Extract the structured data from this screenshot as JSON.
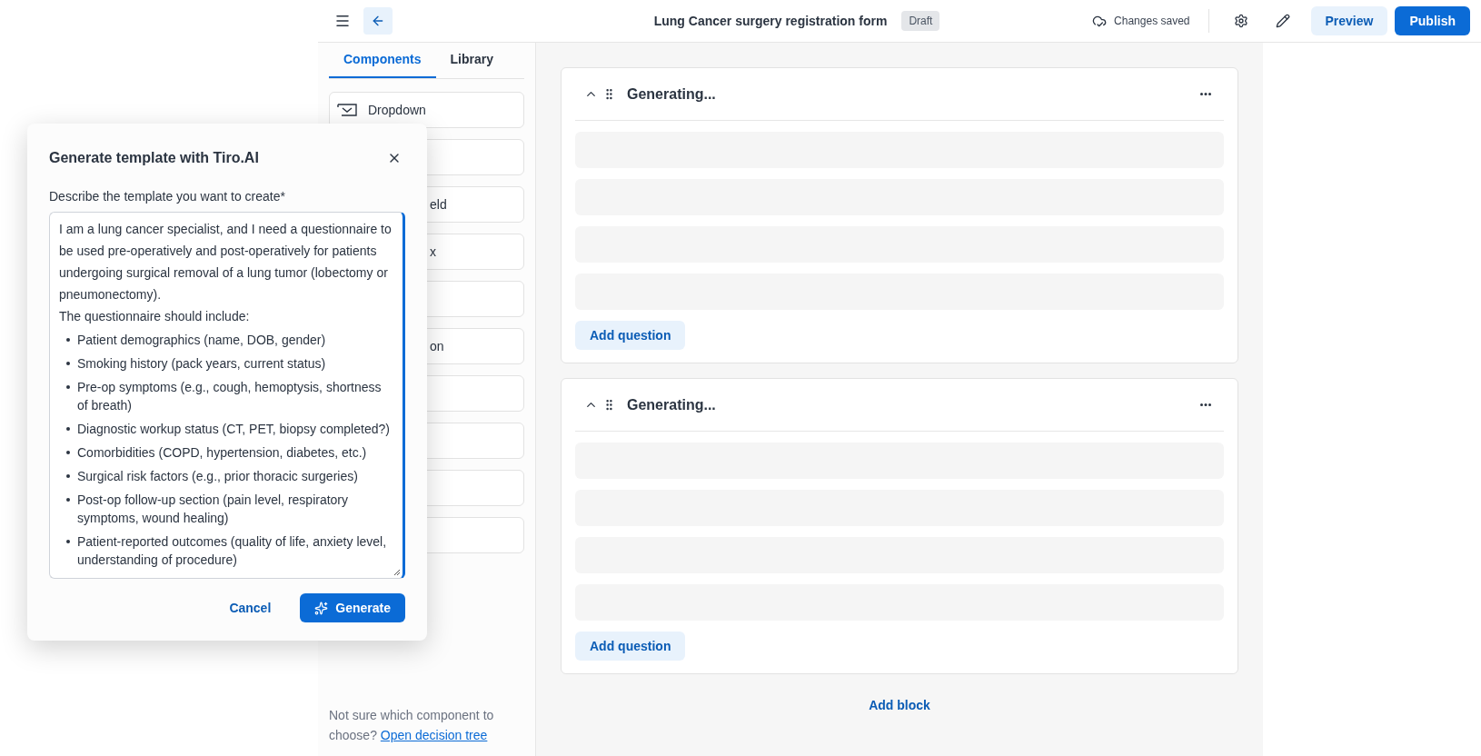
{
  "header": {
    "title": "Lung Cancer surgery registration form",
    "status": "Draft",
    "save_status": "Changes saved",
    "preview": "Preview",
    "publish": "Publish"
  },
  "sidebar": {
    "tabs": [
      {
        "label": "Components",
        "selected": true
      },
      {
        "label": "Library",
        "selected": false
      }
    ],
    "items": [
      {
        "kind": "dropdown",
        "label": "Dropdown"
      },
      {
        "kind": "covered"
      },
      {
        "kind": "covered",
        "label": "eld"
      },
      {
        "kind": "covered",
        "label": "x"
      },
      {
        "kind": "covered"
      },
      {
        "kind": "covered",
        "label": "on"
      },
      {
        "kind": "covered"
      },
      {
        "kind": "covered"
      },
      {
        "kind": "covered"
      },
      {
        "kind": "covered"
      }
    ],
    "help_text": "Not sure which component to choose?",
    "help_link": "Open decision tree"
  },
  "blocks": [
    {
      "title": "Generating...",
      "expanded": true,
      "rows": [
        {
          "loading": true
        },
        {
          "loading": true
        },
        {
          "loading": true
        },
        {
          "loading": true
        }
      ],
      "action": "Add question"
    },
    {
      "title": "Generating...",
      "expanded": true,
      "rows": [
        {
          "loading": true
        },
        {
          "loading": true
        },
        {
          "loading": true
        },
        {
          "loading": true
        }
      ],
      "action": "Add question"
    }
  ],
  "add_block": "Add block",
  "dialog": {
    "title": "Generate template with Tiro.AI",
    "field_label": "Describe the template you want to create*",
    "paragraphs": [
      "I am a lung cancer specialist, and I need a questionnaire to be used pre-operatively and post-operatively for patients undergoing surgical removal of a lung tumor (lobectomy or pneumonectomy).",
      "The questionnaire should include:"
    ],
    "bullets": [
      "Patient demographics (name, DOB, gender)",
      "Smoking history (pack years, current status)",
      "Pre-op symptoms (e.g., cough, hemoptysis, shortness of breath)",
      "Diagnostic workup status (CT, PET, biopsy completed?)",
      "Comorbidities (COPD, hypertension, diabetes, etc.)",
      "Surgical risk factors (e.g., prior thoracic surgeries)",
      "Post-op follow-up section (pain level, respiratory symptoms, wound healing)",
      "Patient-reported outcomes (quality of life, anxiety level, understanding of procedure)"
    ],
    "cancel": "Cancel",
    "generate": "Generate"
  }
}
